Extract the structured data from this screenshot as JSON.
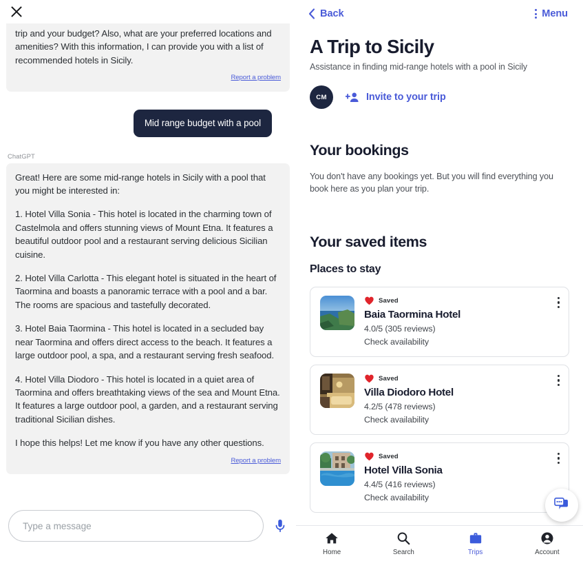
{
  "chat": {
    "close_icon": "close-icon",
    "agent_label": "ChatGPT",
    "first_message": {
      "text": "trip and your budget? Also, what are your preferred locations and amenities? With this information, I can provide you with a list of recommended hotels in Sicily.",
      "report_link": "Report a problem"
    },
    "user_message": "Mid range budget with a pool",
    "assistant_message": {
      "intro": "Great! Here are some mid-range hotels in Sicily with a pool that you might be interested in:",
      "item1": "1. Hotel Villa Sonia - This hotel is located in the charming town of Castelmola and offers stunning views of Mount Etna. It features a beautiful outdoor pool and a restaurant serving delicious Sicilian cuisine.",
      "item2": "2. Hotel Villa Carlotta - This elegant hotel is situated in the heart of Taormina and boasts a panoramic terrace with a pool and a bar. The rooms are spacious and tastefully decorated.",
      "item3": "3. Hotel Baia Taormina - This hotel is located in a secluded bay near Taormina and offers direct access to the beach. It features a large outdoor pool, a spa, and a restaurant serving fresh seafood.",
      "item4": "4. Hotel Villa Diodoro - This hotel is located in a quiet area of Taormina and offers breathtaking views of the sea and Mount Etna. It features a large outdoor pool, a garden, and a restaurant serving traditional Sicilian dishes.",
      "outro": "I hope this helps! Let me know if you have any other questions.",
      "report_link": "Report a problem"
    },
    "composer": {
      "placeholder": "Type a message",
      "value": "",
      "mic_icon": "microphone-icon"
    }
  },
  "trip": {
    "back_label": "Back",
    "back_icon": "chevron-left-icon",
    "menu_label": "Menu",
    "menu_icon": "kebab-menu-icon",
    "title": "A Trip to Sicily",
    "subtitle": "Assistance in finding mid-range hotels with a pool in Sicily",
    "avatar_initials": "CM",
    "invite_label": "Invite to your trip",
    "invite_icon": "add-person-icon",
    "bookings": {
      "heading": "Your bookings",
      "empty_text": "You don't have any bookings yet. But you will find everything you book here as you plan your trip."
    },
    "saved": {
      "heading": "Your saved items",
      "subheading": "Places to stay",
      "items": [
        {
          "saved_label": "Saved",
          "saved_icon": "heart-icon",
          "name": "Baia Taormina Hotel",
          "rating": "4.0/5 (305 reviews)",
          "availability": "Check availability",
          "thumb": "coast-sea-photo",
          "menu_icon": "kebab-menu-icon"
        },
        {
          "saved_label": "Saved",
          "saved_icon": "heart-icon",
          "name": "Villa Diodoro Hotel",
          "rating": "4.2/5 (478 reviews)",
          "availability": "Check availability",
          "thumb": "hotel-room-photo",
          "menu_icon": "kebab-menu-icon"
        },
        {
          "saved_label": "Saved",
          "saved_icon": "heart-icon",
          "name": "Hotel Villa Sonia",
          "rating": "4.4/5 (416 reviews)",
          "availability": "Check availability",
          "thumb": "pool-villa-photo",
          "menu_icon": "kebab-menu-icon"
        }
      ]
    },
    "fab_icon": "chat-bubble-icon",
    "bottom_nav": [
      {
        "label": "Home",
        "icon": "home-icon",
        "active": false
      },
      {
        "label": "Search",
        "icon": "search-icon",
        "active": false
      },
      {
        "label": "Trips",
        "icon": "briefcase-icon",
        "active": true
      },
      {
        "label": "Account",
        "icon": "account-icon",
        "active": false
      }
    ]
  },
  "colors": {
    "accent_blue": "#4a5bd8",
    "dark_navy": "#1d2640",
    "heart_red": "#e0242b",
    "assistant_bubble_bg": "#f2f2f2"
  }
}
